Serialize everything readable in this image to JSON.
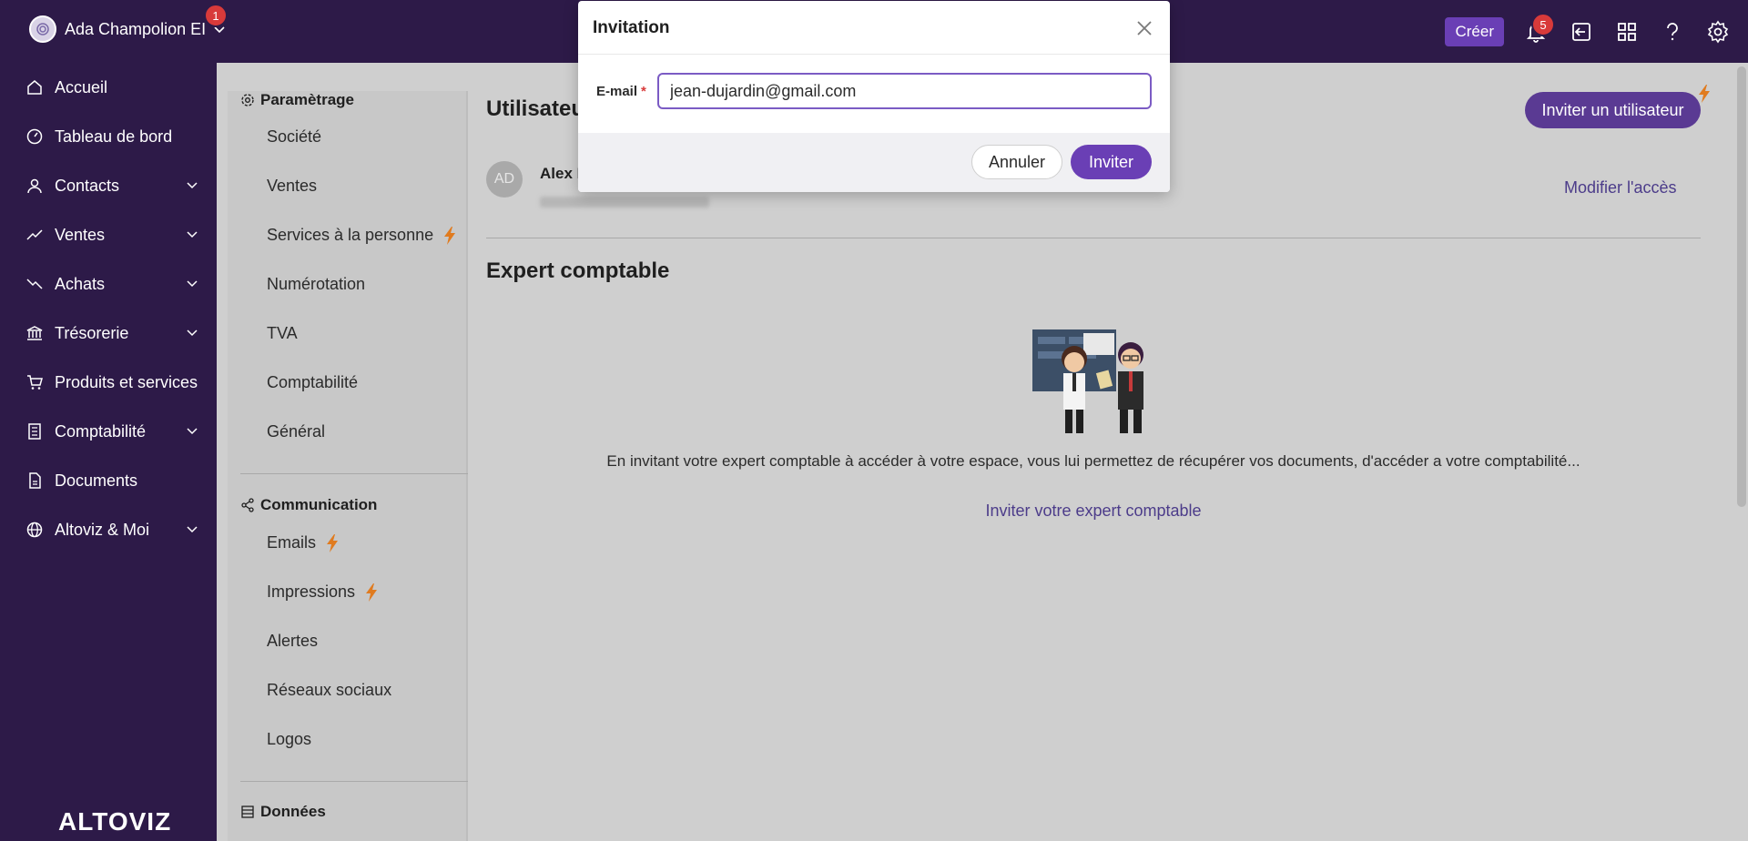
{
  "topbar": {
    "account_name": "Ada Champolion EI",
    "account_badge": "1",
    "create_label": "Créer",
    "notifications_count": "5",
    "icons": [
      "bell-icon",
      "logout-icon",
      "apps-grid-icon",
      "help-icon",
      "gear-icon"
    ]
  },
  "nav": {
    "items": [
      {
        "label": "Accueil",
        "icon": "home-icon"
      },
      {
        "label": "Tableau de bord",
        "icon": "dashboard-icon"
      },
      {
        "label": "Contacts",
        "icon": "user-icon",
        "expandable": true
      },
      {
        "label": "Ventes",
        "icon": "trend-up-icon",
        "expandable": true
      },
      {
        "label": "Achats",
        "icon": "trend-down-icon",
        "expandable": true
      },
      {
        "label": "Trésorerie",
        "icon": "bank-icon",
        "expandable": true
      },
      {
        "label": "Produits et services",
        "icon": "cart-icon"
      },
      {
        "label": "Comptabilité",
        "icon": "ledger-icon",
        "expandable": true
      },
      {
        "label": "Documents",
        "icon": "document-icon"
      },
      {
        "label": "Altoviz & Moi",
        "icon": "globe-icon",
        "expandable": true
      }
    ],
    "logo_text": "ALTOVIZ"
  },
  "settings": {
    "parametrage_title": "Paramètrage",
    "parametrage_items": [
      "Société",
      "Ventes",
      "Services à la personne",
      "Numérotation",
      "TVA",
      "Comptabilité",
      "Général"
    ],
    "communication_title": "Communication",
    "communication_items": [
      "Emails",
      "Impressions",
      "Alertes",
      "Réseaux sociaux",
      "Logos"
    ],
    "donnees_title": "Données"
  },
  "main": {
    "title": "Utilisateu",
    "invite_user_label": "Inviter un utilisateur",
    "user": {
      "initials": "AD",
      "name": "Alex I"
    },
    "modify_access_label": "Modifier l'accès",
    "expert_title": "Expert comptable",
    "expert_description": "En invitant votre expert comptable à accéder à votre espace, vous lui permettez de récupérer vos documents, d'accéder a votre comptabilité...",
    "expert_invite_link": "Inviter votre expert comptable"
  },
  "modal": {
    "title": "Invitation",
    "email_label": "E-mail",
    "required_marker": "*",
    "email_value": "jean-dujardin@gmail.com",
    "cancel_label": "Annuler",
    "invite_label": "Inviter"
  },
  "colors": {
    "sidebar_bg": "#2d1a48",
    "accent": "#6a3fb5",
    "link": "#4c3c8a",
    "badge": "#d83a3a",
    "bolt": "#e07b1f"
  }
}
